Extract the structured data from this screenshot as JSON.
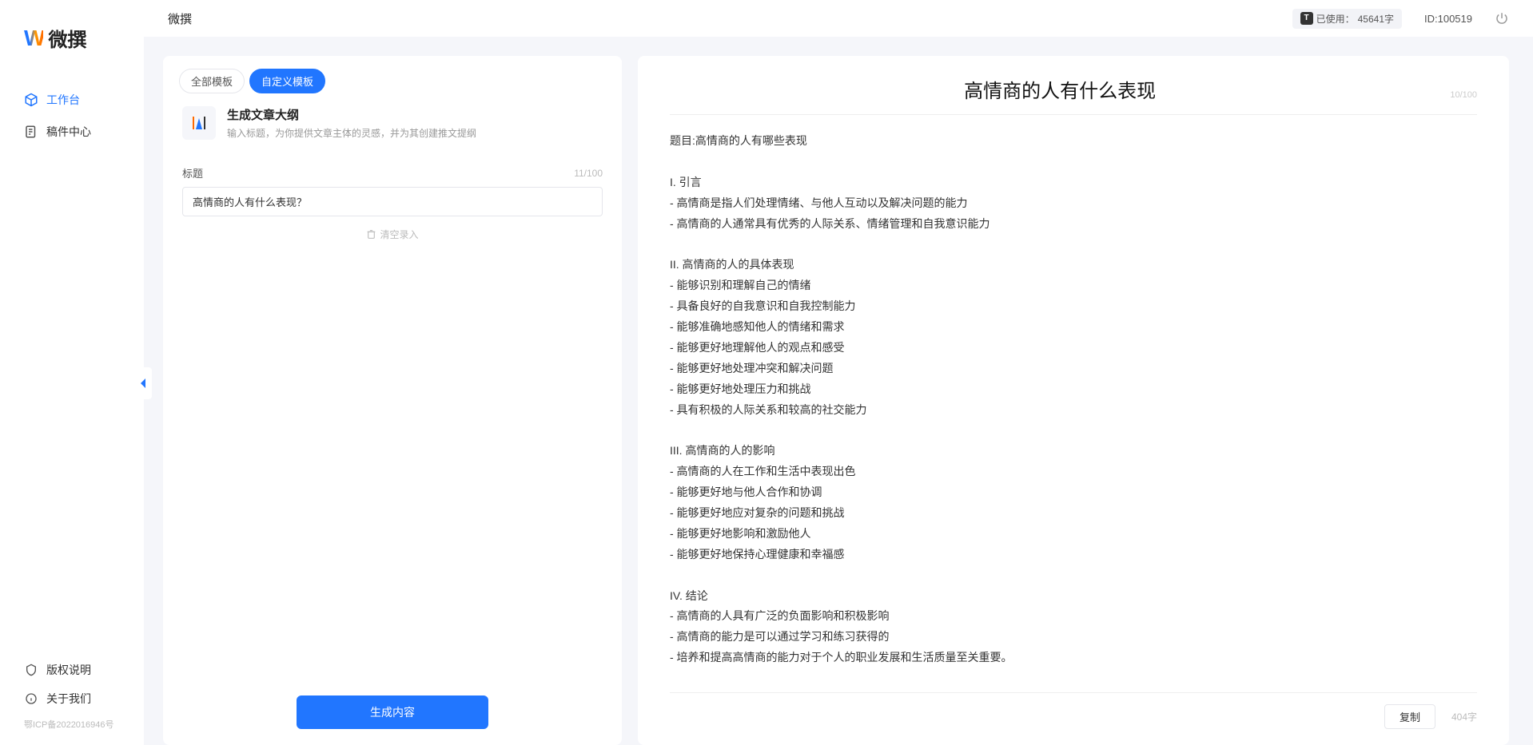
{
  "app": {
    "brand_letter": "W",
    "brand_text": "微撰"
  },
  "topbar": {
    "title": "微撰",
    "usage_label": "已使用：",
    "usage_value": "45641字",
    "id_label": "ID:100519"
  },
  "sidebar": {
    "nav": [
      {
        "label": "工作台",
        "icon": "cube-icon",
        "active": true
      },
      {
        "label": "稿件中心",
        "icon": "doc-icon",
        "active": false
      }
    ],
    "footer": [
      {
        "label": "版权说明",
        "icon": "shield-icon"
      },
      {
        "label": "关于我们",
        "icon": "info-icon"
      }
    ],
    "icp": "鄂ICP备2022016946号"
  },
  "left_panel": {
    "tabs": [
      {
        "label": "全部模板",
        "active": false
      },
      {
        "label": "自定义模板",
        "active": true
      }
    ],
    "template": {
      "name": "生成文章大纲",
      "desc": "输入标题，为你提供文章主体的灵感，并为其创建推文提纲"
    },
    "form": {
      "title_label": "标题",
      "title_counter": "11/100",
      "title_value": "高情商的人有什么表现？",
      "clear_label": "清空录入"
    },
    "generate_btn": "生成内容"
  },
  "right_panel": {
    "title": "高情商的人有什么表现",
    "title_counter": "10/100",
    "body": "题目:高情商的人有哪些表现\n\nI. 引言\n- 高情商是指人们处理情绪、与他人互动以及解决问题的能力\n- 高情商的人通常具有优秀的人际关系、情绪管理和自我意识能力\n\nII. 高情商的人的具体表现\n- 能够识别和理解自己的情绪\n- 具备良好的自我意识和自我控制能力\n- 能够准确地感知他人的情绪和需求\n- 能够更好地理解他人的观点和感受\n- 能够更好地处理冲突和解决问题\n- 能够更好地处理压力和挑战\n- 具有积极的人际关系和较高的社交能力\n\nIII. 高情商的人的影响\n- 高情商的人在工作和生活中表现出色\n- 能够更好地与他人合作和协调\n- 能够更好地应对复杂的问题和挑战\n- 能够更好地影响和激励他人\n- 能够更好地保持心理健康和幸福感\n\nIV. 结论\n- 高情商的人具有广泛的负面影响和积极影响\n- 高情商的能力是可以通过学习和练习获得的\n- 培养和提高高情商的能力对于个人的职业发展和生活质量至关重要。",
    "copy_btn": "复制",
    "word_count": "404字"
  }
}
